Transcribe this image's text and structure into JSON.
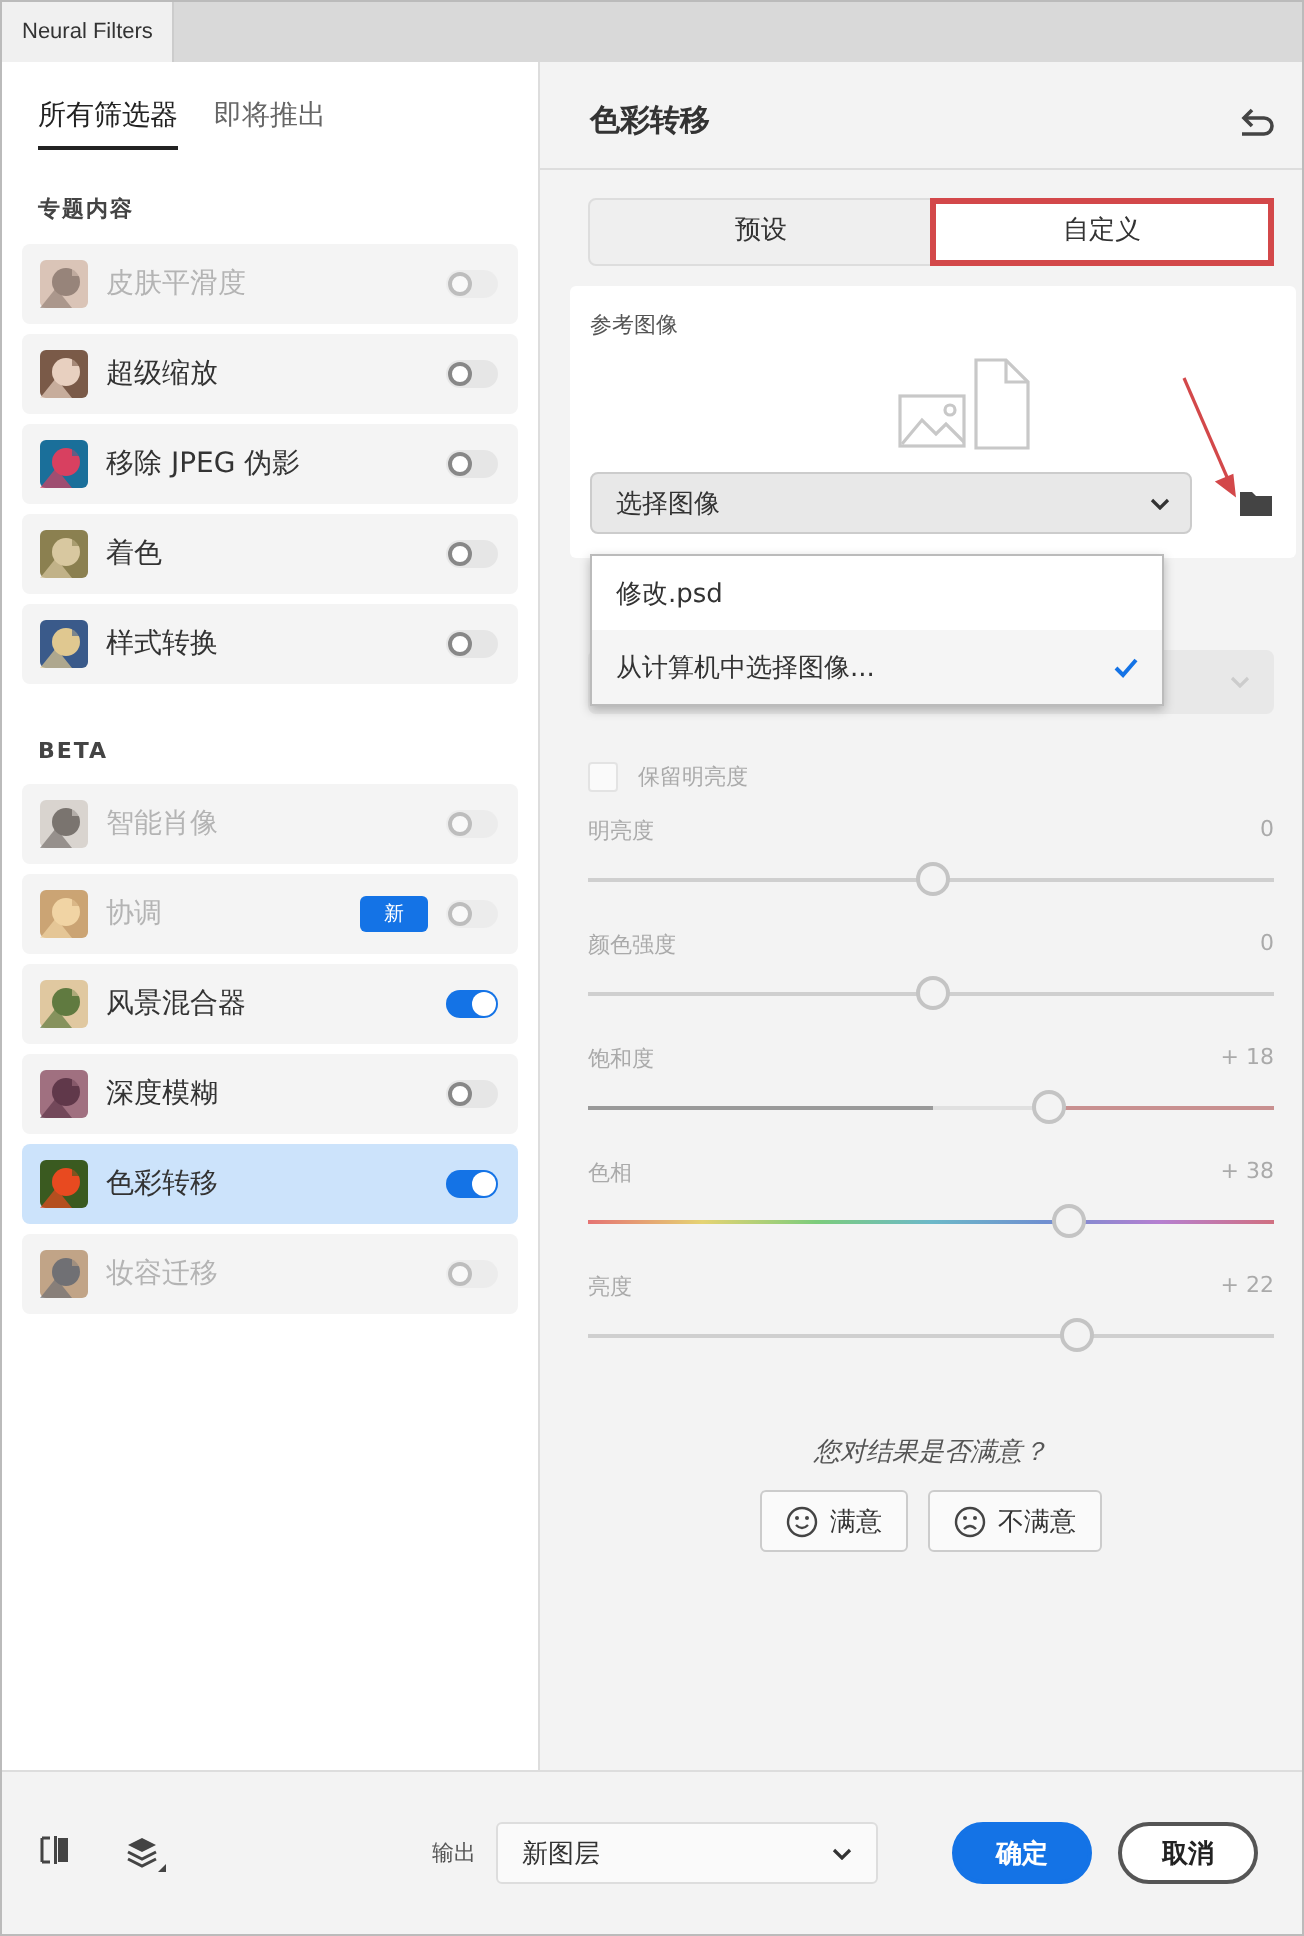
{
  "window": {
    "tab": "Neural Filters"
  },
  "sidebar": {
    "tabs": [
      {
        "label": "所有筛选器",
        "selected": true
      },
      {
        "label": "即将推出",
        "selected": false
      }
    ],
    "groups": [
      {
        "title": "专题内容",
        "items": [
          {
            "name": "皮肤平滑度",
            "disabled": true,
            "on": false,
            "selected": false
          },
          {
            "name": "超级缩放",
            "disabled": false,
            "on": false,
            "selected": false
          },
          {
            "name": "移除 JPEG 伪影",
            "disabled": false,
            "on": false,
            "selected": false
          },
          {
            "name": "着色",
            "disabled": false,
            "on": false,
            "selected": false
          },
          {
            "name": "样式转换",
            "disabled": false,
            "on": false,
            "selected": false
          }
        ]
      },
      {
        "title": "BETA",
        "items": [
          {
            "name": "智能肖像",
            "disabled": true,
            "on": false,
            "selected": false
          },
          {
            "name": "协调",
            "disabled": true,
            "on": false,
            "selected": false,
            "badge": "新"
          },
          {
            "name": "风景混合器",
            "disabled": false,
            "on": true,
            "selected": false
          },
          {
            "name": "深度模糊",
            "disabled": false,
            "on": false,
            "selected": false
          },
          {
            "name": "色彩转移",
            "disabled": false,
            "on": true,
            "selected": true
          },
          {
            "name": "妆容迁移",
            "disabled": true,
            "on": false,
            "selected": false
          }
        ]
      }
    ]
  },
  "panel": {
    "title": "色彩转移",
    "tabs": [
      {
        "label": "预设",
        "selected": false,
        "highlighted": false
      },
      {
        "label": "自定义",
        "selected": true,
        "highlighted": true
      }
    ],
    "reference": {
      "label": "参考图像",
      "select": "选择图像",
      "annotation_arrow": true,
      "menu": [
        {
          "label": "修改.psd",
          "selected": false
        },
        {
          "label": "从计算机中选择图像...",
          "selected": true
        }
      ]
    },
    "checkbox": {
      "label": "保留明亮度",
      "checked": false,
      "disabled": true
    },
    "sliders": [
      {
        "kind": "plain",
        "label": "明亮度",
        "reading": "0",
        "level": 0.5
      },
      {
        "kind": "plain",
        "label": "颜色强度",
        "reading": "0",
        "level": 0.5
      },
      {
        "kind": "saturation",
        "label": "饱和度",
        "reading": "+ 18",
        "level": 0.67
      },
      {
        "kind": "hue",
        "label": "色相",
        "reading": "+ 38",
        "level": 0.7
      },
      {
        "kind": "plain",
        "label": "亮度",
        "reading": "+ 22",
        "level": 0.71
      }
    ],
    "feedback": {
      "question": "您对结果是否满意？",
      "buttons": [
        {
          "kind": "happy",
          "label": "满意"
        },
        {
          "kind": "sad",
          "label": "不满意"
        }
      ]
    }
  },
  "footer": {
    "output_label": "输出",
    "output": "新图层",
    "buttons": [
      {
        "kind": "primary",
        "label": "确定"
      },
      {
        "kind": "secondary",
        "label": "取消"
      }
    ]
  }
}
